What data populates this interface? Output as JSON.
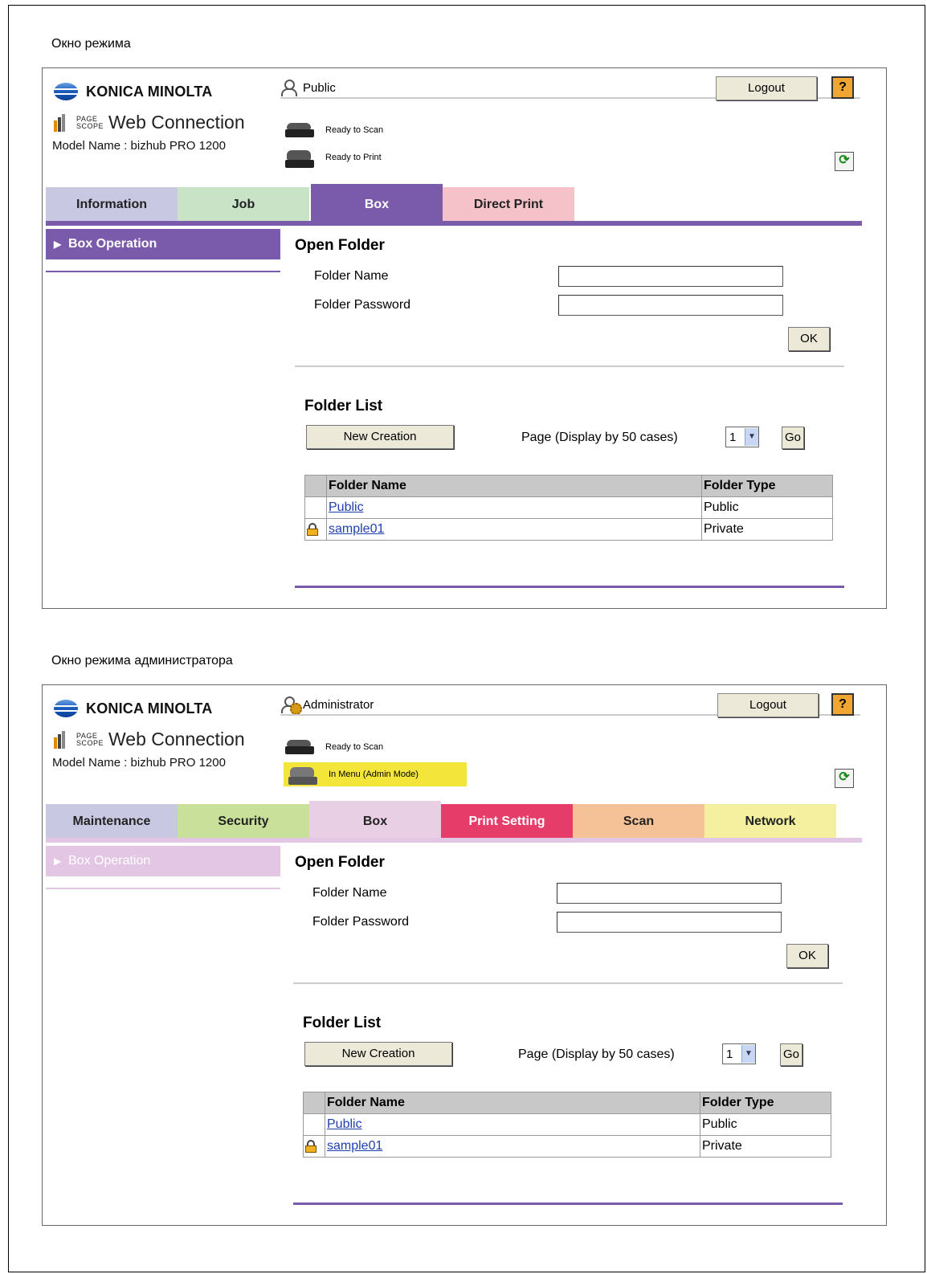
{
  "captions": {
    "user_window": "Окно режима",
    "admin_window": "Окно режима администратора"
  },
  "screens": [
    {
      "brand": "KONICA MINOLTA",
      "pagescope_line1": "PAGE",
      "pagescope_line2": "SCOPE",
      "product": "Web Connection",
      "model": "Model Name : bizhub PRO 1200",
      "user": "Public",
      "user_icon": "user-icon",
      "logout_label": "Logout",
      "help_label": "?",
      "status": [
        {
          "icon": "scanner-icon",
          "text": "Ready to Scan"
        },
        {
          "icon": "printer-icon",
          "text": "Ready to Print"
        }
      ],
      "refresh_icon": "refresh-icon",
      "accent": "#7a5aaa",
      "tabs": [
        {
          "label": "Information",
          "color": "#c9c8e3",
          "text_color": "#222"
        },
        {
          "label": "Job",
          "color": "#c8e3c6",
          "text_color": "#222"
        },
        {
          "label": "Box",
          "color": "#7a5aaa",
          "text_color": "#ffffff",
          "active": true
        },
        {
          "label": "Direct Print",
          "color": "#f4c2c8",
          "text_color": "#222"
        }
      ],
      "sidebar_item": "Box Operation",
      "open_folder": {
        "title": "Open Folder",
        "name_label": "Folder Name",
        "name_value": "",
        "password_label": "Folder Password",
        "password_value": "",
        "ok_label": "OK"
      },
      "folder_list": {
        "title": "Folder List",
        "new_label": "New Creation",
        "page_label": "Page (Display by 50 cases)",
        "page_value": "1",
        "go_label": "Go",
        "headers": [
          "Folder Name",
          "Folder Type"
        ],
        "rows": [
          {
            "locked": false,
            "name": "Public",
            "type": "Public"
          },
          {
            "locked": true,
            "name": "sample01",
            "type": "Private"
          }
        ]
      }
    },
    {
      "brand": "KONICA MINOLTA",
      "pagescope_line1": "PAGE",
      "pagescope_line2": "SCOPE",
      "product": "Web Connection",
      "model": "Model Name : bizhub PRO 1200",
      "user": "Administrator",
      "user_icon": "admin-user-icon",
      "logout_label": "Logout",
      "help_label": "?",
      "status": [
        {
          "icon": "scanner-icon",
          "text": "Ready to Scan"
        },
        {
          "icon": "machine-icon",
          "text": "In Menu (Admin Mode)",
          "highlight": "#f4e53a"
        }
      ],
      "refresh_icon": "refresh-icon",
      "accent": "#e3c6e3",
      "tabs": [
        {
          "label": "Maintenance",
          "color": "#c9c8e3",
          "text_color": "#222"
        },
        {
          "label": "Security",
          "color": "#c8e09a",
          "text_color": "#222"
        },
        {
          "label": "Box",
          "color": "#e8cfe3",
          "text_color": "#222",
          "active": true
        },
        {
          "label": "Print Setting",
          "color": "#e63c6a",
          "text_color": "#ffffff"
        },
        {
          "label": "Scan",
          "color": "#f4c296",
          "text_color": "#222"
        },
        {
          "label": "Network",
          "color": "#f4f0a0",
          "text_color": "#222"
        }
      ],
      "sidebar_item": "Box Operation",
      "open_folder": {
        "title": "Open Folder",
        "name_label": "Folder Name",
        "name_value": "",
        "password_label": "Folder Password",
        "password_value": "",
        "ok_label": "OK"
      },
      "folder_list": {
        "title": "Folder List",
        "new_label": "New Creation",
        "page_label": "Page (Display by 50 cases)",
        "page_value": "1",
        "go_label": "Go",
        "headers": [
          "Folder Name",
          "Folder Type"
        ],
        "rows": [
          {
            "locked": false,
            "name": "Public",
            "type": "Public"
          },
          {
            "locked": true,
            "name": "sample01",
            "type": "Private"
          }
        ]
      }
    }
  ]
}
